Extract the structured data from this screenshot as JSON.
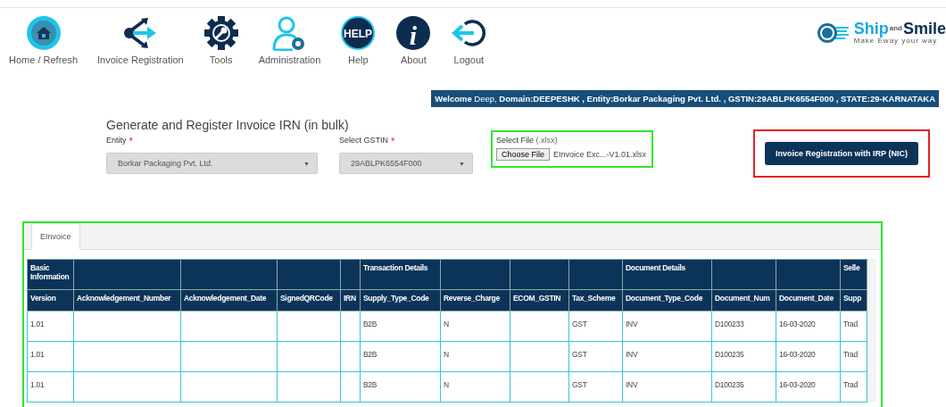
{
  "nav": {
    "items": [
      {
        "kind": "home",
        "label": "Home / Refresh"
      },
      {
        "kind": "share",
        "label": "Invoice Registration"
      },
      {
        "kind": "tools",
        "label": "Tools"
      },
      {
        "kind": "admin",
        "label": "Administration"
      },
      {
        "kind": "help",
        "label": "Help",
        "badge": "HELP"
      },
      {
        "kind": "about",
        "label": "About",
        "badge": "i"
      },
      {
        "kind": "logout",
        "label": "Logout"
      }
    ],
    "logo": {
      "word1": "Ship",
      "joiner": "and",
      "word2": "Smile",
      "tagline": "Make Eway your way"
    }
  },
  "welcome": "**Welcome** Deep,  **Domain:DEEPESHK , Entity:Borkar Packaging Pvt. Ltd. , GSTIN:29ABLPK6554F000 , STATE:29-KARNATAKA**",
  "form": {
    "title": "Generate and Register Invoice IRN (in bulk)",
    "entity": {
      "label": "Entity",
      "required_mark": "*",
      "value": "Borkar Packaging Pvt. Ltd.",
      "caret": "▼"
    },
    "gstin": {
      "label": "Select GSTIN",
      "required_mark": "*",
      "value": "29ABLPK6554F000",
      "caret": "▼"
    },
    "file": {
      "label": "Select File",
      "hint": "(.xlsx)",
      "button": "Choose File",
      "file_name": "EInvoice Exc...-V1.01.xlsx"
    },
    "submit": "Invoice Registration with IRP (NIC)"
  },
  "tabs": [
    {
      "label": "EInvoice",
      "selected": true
    }
  ],
  "table": {
    "columns": [
      {
        "group": "Basic Information",
        "label": "Version"
      },
      {
        "label": "Acknowledgement_Number"
      },
      {
        "label": "Acknowledgement_Date"
      },
      {
        "label": "SignedQRCode"
      },
      {
        "label": "IRN"
      },
      {
        "group": "Transaction Details",
        "label": "Supply_Type_Code"
      },
      {
        "label": "Reverse_Charge"
      },
      {
        "label": "ECOM_GSTIN"
      },
      {
        "label": "Tax_Scheme"
      },
      {
        "group": "Document Details",
        "label": "Document_Type_Code"
      },
      {
        "label": "Document_Num"
      },
      {
        "label": "Document_Date"
      },
      {
        "group": "Selle",
        "label": "Supp"
      }
    ],
    "rows": [
      {
        "cells": [
          "1.01",
          null,
          null,
          null,
          null,
          "B2B",
          "N",
          null,
          "GST",
          "INV",
          "D100233",
          "16-03-2020",
          "Trad"
        ]
      },
      {
        "cells": [
          "1.01",
          null,
          null,
          null,
          null,
          "B2B",
          "N",
          null,
          "GST",
          "INV",
          "D100235",
          "16-03-2020",
          "Trad"
        ]
      },
      {
        "cells": [
          "1.01",
          null,
          null,
          null,
          null,
          "B2B",
          "N",
          null,
          "GST",
          "INV",
          "D100235",
          "16-03-2020",
          "Trad"
        ]
      }
    ]
  }
}
